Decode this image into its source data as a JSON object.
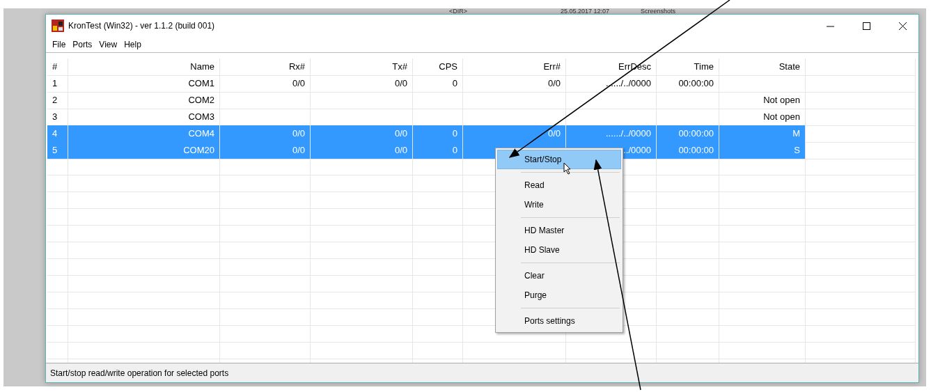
{
  "background": {
    "texts": [
      "<DIR>",
      "25.05.2017 12:07",
      "Screenshots"
    ]
  },
  "window": {
    "title": "KronTest (Win32) - ver 1.1.2 (build 001)"
  },
  "menu": [
    "File",
    "Ports",
    "View",
    "Help"
  ],
  "table": {
    "columns": [
      "#",
      "Name",
      "Rx#",
      "Tx#",
      "CPS",
      "Err#",
      "ErrDesc",
      "Time",
      "State"
    ],
    "rows": [
      {
        "selected": false,
        "cells": [
          "1",
          "COM1",
          "0/0",
          "0/0",
          "0",
          "0/0",
          "....../../0000",
          "00:00:00",
          ""
        ]
      },
      {
        "selected": false,
        "cells": [
          "2",
          "COM2",
          "",
          "",
          "",
          "",
          "",
          "",
          "Not open"
        ]
      },
      {
        "selected": false,
        "cells": [
          "3",
          "COM3",
          "",
          "",
          "",
          "",
          "",
          "",
          "Not open"
        ]
      },
      {
        "selected": true,
        "cells": [
          "4",
          "COM4",
          "0/0",
          "0/0",
          "0",
          "0/0",
          "....../../0000",
          "00:00:00",
          "M"
        ]
      },
      {
        "selected": true,
        "cells": [
          "5",
          "COM20",
          "0/0",
          "0/0",
          "0",
          "",
          "../0000",
          "00:00:00",
          "S"
        ]
      }
    ]
  },
  "context_menu": [
    {
      "kind": "item",
      "label": "Start/Stop",
      "selected": true
    },
    {
      "kind": "separator"
    },
    {
      "kind": "item",
      "label": "Read",
      "selected": false
    },
    {
      "kind": "item",
      "label": "Write",
      "selected": false
    },
    {
      "kind": "separator"
    },
    {
      "kind": "item",
      "label": "HD Master",
      "selected": false
    },
    {
      "kind": "item",
      "label": "HD Slave",
      "selected": false
    },
    {
      "kind": "separator"
    },
    {
      "kind": "item",
      "label": "Clear",
      "selected": false
    },
    {
      "kind": "item",
      "label": "Purge",
      "selected": false
    },
    {
      "kind": "separator"
    },
    {
      "kind": "item",
      "label": "Ports settings",
      "selected": false
    }
  ],
  "status_bar": "Start/stop read/write operation for selected ports"
}
